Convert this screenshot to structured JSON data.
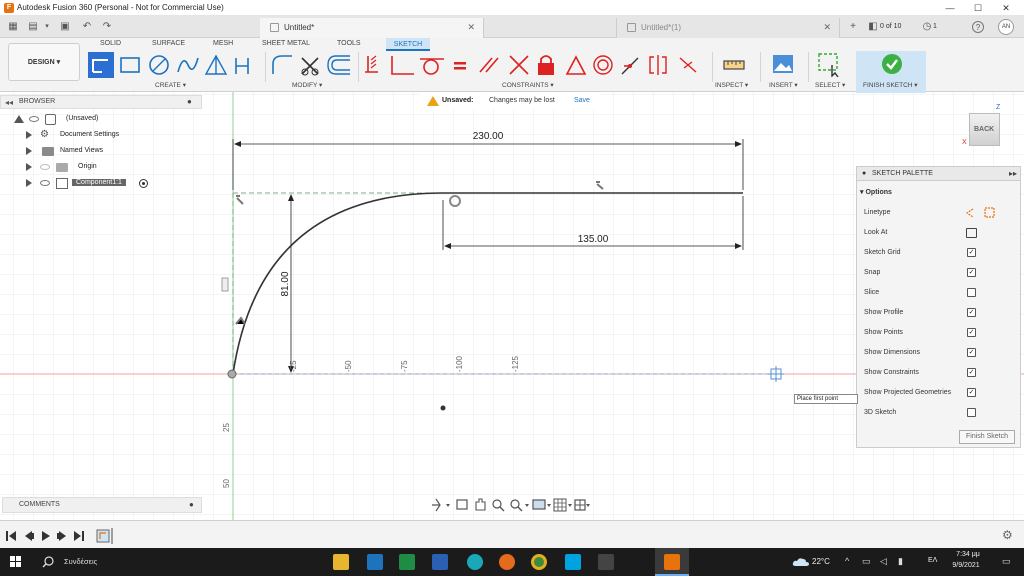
{
  "window": {
    "title": "Autodesk Fusion 360 (Personal - Not for Commercial Use)",
    "minimize": "—",
    "maximize": "☐",
    "close": "✕"
  },
  "tabs": {
    "doc1": {
      "label": "Untitled*",
      "close": "✕"
    },
    "doc2": {
      "label": "Untitled*(1)",
      "close": "✕"
    },
    "jobs": "0 of 10",
    "notifications": "1",
    "help": "?",
    "avatar": "AN"
  },
  "toolbar": {
    "design": "DESIGN ▾",
    "workspaces": [
      "SOLID",
      "SURFACE",
      "MESH",
      "SHEET METAL",
      "TOOLS",
      "SKETCH"
    ],
    "groups": {
      "create": "CREATE ▾",
      "modify": "MODIFY ▾",
      "constraints": "CONSTRAINTS ▾",
      "inspect": "INSPECT ▾",
      "insert": "INSERT ▾",
      "select": "SELECT ▾",
      "finish": "FINISH SKETCH ▾"
    }
  },
  "browser": {
    "title": "BROWSER",
    "items": [
      "(Unsaved)",
      "Document Settings",
      "Named Views",
      "Origin",
      "Component1:1"
    ]
  },
  "comments": {
    "title": "COMMENTS"
  },
  "banner": {
    "title": "Unsaved:",
    "message": "Changes may be lost",
    "save": "Save"
  },
  "viewcube": {
    "face": "BACK",
    "axis_x": "X",
    "axis_z": "Z"
  },
  "sketch": {
    "dims": {
      "overall": "230.00",
      "right": "135.00",
      "height": "81.00"
    },
    "ruler_h": [
      "-25",
      "-50",
      "-75",
      "-100",
      "-125"
    ],
    "ruler_v": [
      "25",
      "50"
    ]
  },
  "tooltip": "Place first point",
  "palette": {
    "title": "SKETCH PALETTE",
    "options_title": "Options",
    "rows": [
      {
        "label": "Linetype"
      },
      {
        "label": "Look At"
      },
      {
        "label": "Sketch Grid",
        "checked": true
      },
      {
        "label": "Snap",
        "checked": true
      },
      {
        "label": "Slice",
        "checked": false
      },
      {
        "label": "Show Profile",
        "checked": true
      },
      {
        "label": "Show Points",
        "checked": true
      },
      {
        "label": "Show Dimensions",
        "checked": true
      },
      {
        "label": "Show Constraints",
        "checked": true
      },
      {
        "label": "Show Projected Geometries",
        "checked": true
      },
      {
        "label": "3D Sketch",
        "checked": false
      }
    ],
    "finish": "Finish Sketch"
  },
  "taskbar": {
    "search": "Συνδέσεις",
    "temperature": "22°C",
    "language": "ΕΛ",
    "time": "7:34 μμ",
    "date": "9/9/2021"
  },
  "colors": {
    "accent": "#1e73be",
    "finish_green": "#3cb043",
    "sketch_red": "#d22",
    "orange_brand": "#e8720c"
  }
}
